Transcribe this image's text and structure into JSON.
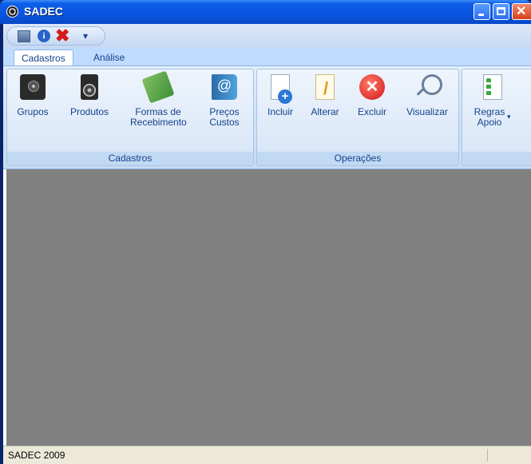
{
  "window": {
    "title": "SADEC"
  },
  "tabs": [
    {
      "label": "Cadastros",
      "active": true
    },
    {
      "label": "Análise",
      "active": false
    }
  ],
  "groups": {
    "cadastros": {
      "label": "Cadastros",
      "buttons": [
        {
          "label": "Grupos",
          "icon": "speaker-icon"
        },
        {
          "label": "Produtos",
          "icon": "speaker-icon"
        },
        {
          "label": "Formas de Recebimento",
          "icon": "money-icon"
        },
        {
          "label": "Preços Custos",
          "icon": "address-book-icon"
        }
      ]
    },
    "operacoes": {
      "label": "Operações",
      "buttons": [
        {
          "label": "Incluir",
          "icon": "new-document-icon"
        },
        {
          "label": "Alterar",
          "icon": "edit-document-icon"
        },
        {
          "label": "Excluir",
          "icon": "delete-icon"
        },
        {
          "label": "Visualizar",
          "icon": "magnifier-icon"
        }
      ]
    },
    "regras": {
      "buttons": [
        {
          "label": "Regras Apoio",
          "icon": "list-icon",
          "has_dropdown": true
        }
      ]
    }
  },
  "status": {
    "text": "SADEC 2009"
  },
  "colors": {
    "title_bar": "#0a55e0",
    "ribbon": "#d3e3f7",
    "workspace": "#808080",
    "status_bar": "#ece9d8"
  }
}
